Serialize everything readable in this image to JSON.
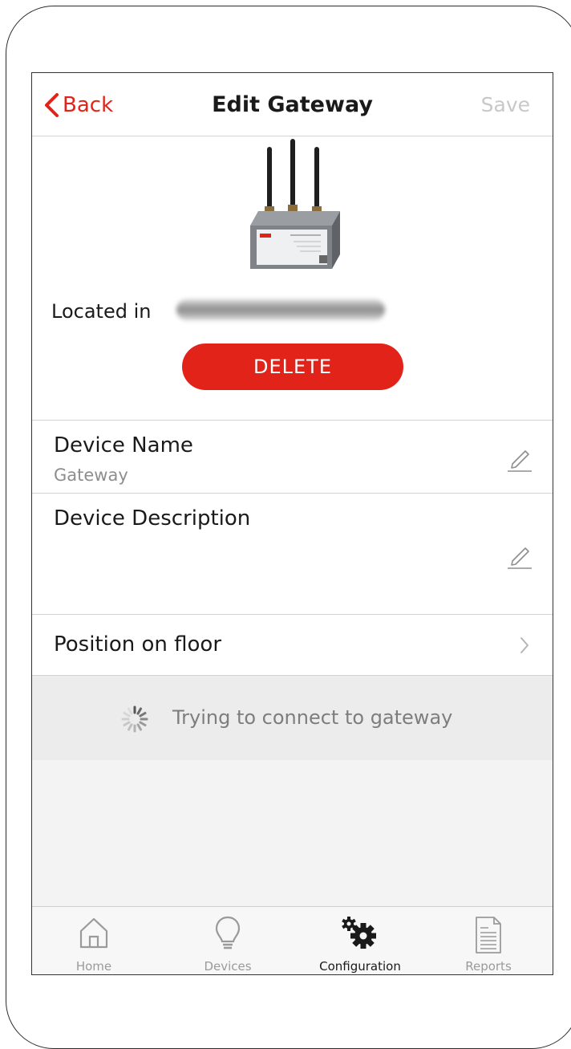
{
  "nav": {
    "back_label": "Back",
    "title": "Edit Gateway",
    "save_label": "Save"
  },
  "device": {
    "image_icon": "gateway-device-image",
    "located_label": "Located in",
    "location_value_blurred": true,
    "delete_label": "DELETE"
  },
  "fields": {
    "name": {
      "label": "Device Name",
      "value": "Gateway",
      "icon": "pencil-icon"
    },
    "description": {
      "label": "Device Description",
      "value": "",
      "icon": "pencil-icon"
    },
    "position": {
      "label": "Position on floor",
      "icon": "chevron-right-icon"
    }
  },
  "status": {
    "text": "Trying to connect to gateway",
    "icon": "spinner-icon"
  },
  "tabs": [
    {
      "label": "Home",
      "icon": "home-icon",
      "active": false
    },
    {
      "label": "Devices",
      "icon": "lightbulb-icon",
      "active": false
    },
    {
      "label": "Configuration",
      "icon": "gears-icon",
      "active": true
    },
    {
      "label": "Reports",
      "icon": "document-icon",
      "active": false
    }
  ],
  "colors": {
    "accent": "#e2231a",
    "disabled": "#c8c8c8",
    "muted_text": "#8e8e8e",
    "status_bg": "#ececec"
  }
}
